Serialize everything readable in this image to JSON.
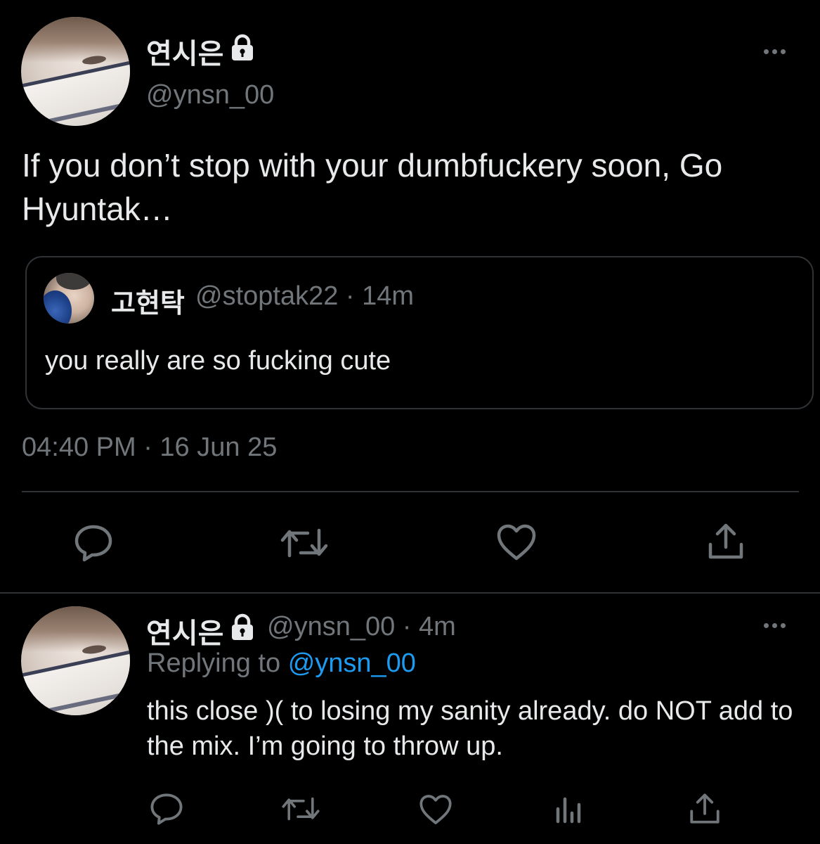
{
  "main_tweet": {
    "display_name": "연시은",
    "handle": "@ynsn_00",
    "avatar_icon": "avatar-photo",
    "lock_icon": "lock-icon",
    "more_icon": "more-dots-icon",
    "text": "If you don’t stop with your dumbfuckery soon, Go Hyuntak…",
    "quoted_tweet": {
      "display_name": "고현탁",
      "meta": "@stoptak22 · 14m",
      "text": "you really are so fucking cute"
    },
    "timestamp": "04:40 PM · 16 Jun 25",
    "actions": [
      "reply-icon",
      "retweet-icon",
      "like-icon",
      "share-icon"
    ]
  },
  "reply_tweet": {
    "display_name": "연시은",
    "meta": "@ynsn_00 · 4m",
    "replying_label": "Replying to",
    "replying_handle": "@ynsn_00",
    "text": "this close )( to losing my sanity already. do NOT add to the mix. I’m going to throw up.",
    "actions": [
      "reply-icon",
      "retweet-icon",
      "like-icon",
      "analytics-icon",
      "share-icon"
    ]
  },
  "colors": {
    "background": "#000000",
    "text_primary": "#e7e9ea",
    "text_secondary": "#71767b",
    "link": "#1d9bf0",
    "border": "#2f3336"
  }
}
